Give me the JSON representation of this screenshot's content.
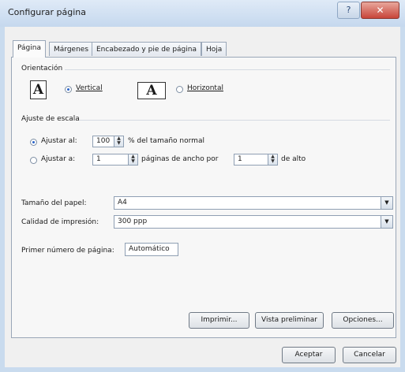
{
  "window": {
    "title": "Configurar página",
    "help": "?",
    "close": "✕"
  },
  "tabs": [
    "Página",
    "Márgenes",
    "Encabezado y pie de página",
    "Hoja"
  ],
  "orientation": {
    "heading": "Orientación",
    "vertical_label": "Vertical",
    "horizontal_label": "Horizontal",
    "vertical_glyph": "A",
    "horizontal_glyph": "A",
    "selected": "vertical"
  },
  "scale": {
    "heading": "Ajuste de escala",
    "adjust_label": "Ajustar al:",
    "adjust_value": "100",
    "adjust_suffix": "% del tamaño normal",
    "fit_label": "Ajustar a:",
    "fit_wide_value": "1",
    "fit_middle": "páginas de ancho por",
    "fit_tall_value": "1",
    "fit_suffix": "de alto",
    "selected": "adjust"
  },
  "paper": {
    "label": "Tamaño del papel:",
    "value": "A4"
  },
  "quality": {
    "label": "Calidad de impresión:",
    "value": "300 ppp"
  },
  "first_page": {
    "label": "Primer número de página:",
    "value": "Automático"
  },
  "buttons": {
    "print": "Imprimir...",
    "preview": "Vista preliminar",
    "options": "Opciones...",
    "accept": "Aceptar",
    "cancel": "Cancelar"
  }
}
